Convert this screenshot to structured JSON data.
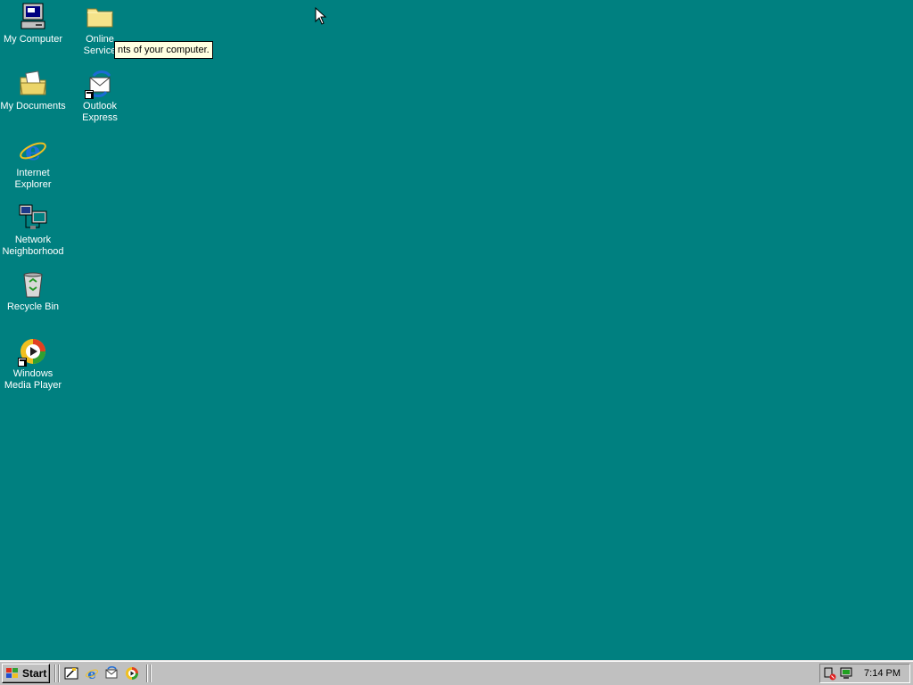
{
  "desktop": {
    "background_color": "#008080",
    "icons": [
      {
        "label": "My Computer",
        "icon": "my-computer-icon"
      },
      {
        "label": "Online\nService",
        "icon": "folder-icon"
      },
      {
        "label": "My Documents",
        "icon": "my-documents-icon"
      },
      {
        "label": "Outlook\nExpress",
        "icon": "outlook-express-icon"
      },
      {
        "label": "Internet\nExplorer",
        "icon": "internet-explorer-icon"
      },
      {
        "label": "Network\nNeighborhood",
        "icon": "network-neighborhood-icon"
      },
      {
        "label": "Recycle Bin",
        "icon": "recycle-bin-icon"
      },
      {
        "label": "Windows\nMedia Player",
        "icon": "windows-media-player-icon"
      }
    ]
  },
  "tooltip": {
    "text": "nts of your computer."
  },
  "taskbar": {
    "start_label": "Start",
    "quick_launch": [
      {
        "icon": "show-desktop-icon"
      },
      {
        "icon": "internet-explorer-icon"
      },
      {
        "icon": "outlook-express-icon"
      },
      {
        "icon": "windows-media-player-icon"
      }
    ],
    "tray_icons": [
      {
        "icon": "volume-icon"
      },
      {
        "icon": "network-tray-icon"
      }
    ],
    "clock": "7:14 PM"
  }
}
